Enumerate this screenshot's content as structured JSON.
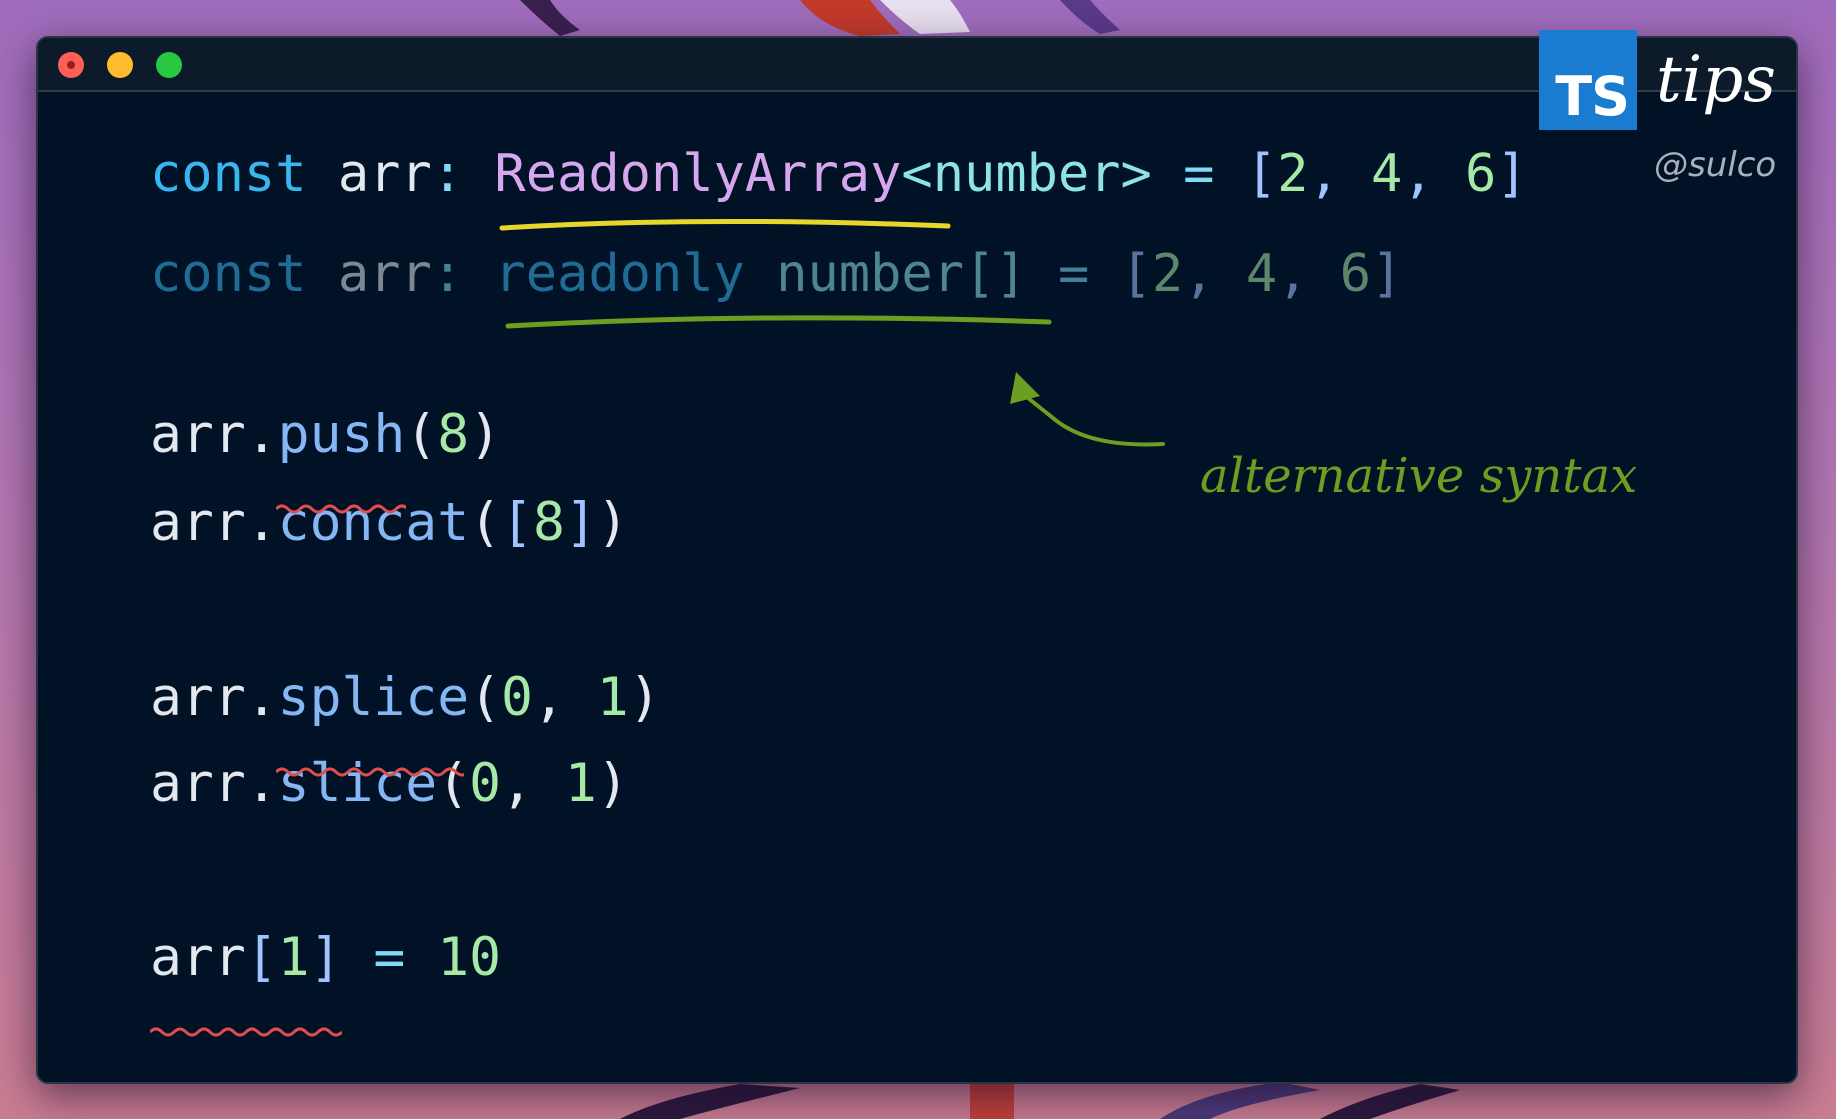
{
  "code": {
    "line1": {
      "kw": "const",
      "var": "arr",
      "colon": ":",
      "type_name": "ReadonlyArray",
      "generic": "<number>",
      "eq": "=",
      "open": "[",
      "n1": "2",
      "comma1": ",",
      "n2": "4",
      "comma2": ",",
      "n3": "6",
      "close": "]"
    },
    "line2": {
      "kw": "const",
      "var": "arr",
      "colon": ":",
      "modifier": "readonly",
      "type_name": "number[]",
      "eq": "=",
      "open": "[",
      "n1": "2",
      "comma1": ",",
      "n2": "4",
      "comma2": ",",
      "n3": "6",
      "close": "]"
    },
    "line3": {
      "obj": "arr",
      "dot": ".",
      "method": "push",
      "open": "(",
      "arg": "8",
      "close": ")"
    },
    "line4": {
      "obj": "arr",
      "dot": ".",
      "method": "concat",
      "open": "(",
      "bopen": "[",
      "arg": "8",
      "bclose": "]",
      "close": ")"
    },
    "line5": {
      "obj": "arr",
      "dot": ".",
      "method": "splice",
      "open": "(",
      "a1": "0",
      "comma": ",",
      "a2": "1",
      "close": ")"
    },
    "line6": {
      "obj": "arr",
      "dot": ".",
      "method": "slice",
      "open": "(",
      "a1": "0",
      "comma": ",",
      "a2": "1",
      "close": ")"
    },
    "line7": {
      "obj": "arr",
      "bopen": "[",
      "idx": "1",
      "bclose": "]",
      "eq": "=",
      "val": "10"
    }
  },
  "annotation": {
    "text": "alternative syntax",
    "color": "#6c9e22"
  },
  "brand": {
    "logo": "TS",
    "title": "tips",
    "handle": "@sulco",
    "logo_color": "#1a7cd0"
  },
  "colors": {
    "editor_bg": "#021226",
    "keyword": "#38b6f0",
    "type": "#d7a7ee",
    "number": "#a6e8a6",
    "method": "#86b7f5",
    "error_squiggle": "#e24d4d",
    "underline_primary": "#e6d82a",
    "underline_alt": "#6c9e22"
  }
}
